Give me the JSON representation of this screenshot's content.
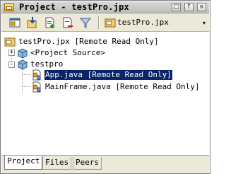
{
  "window": {
    "title": "Project - testPro.jpx",
    "buttons": {
      "restore": "□",
      "pin": "↑",
      "close": "×"
    }
  },
  "toolbar": {
    "project_selector_label": "testPro.jpx",
    "dropdown_glyph": "▾",
    "icons": [
      "project-pane-icon",
      "import-icon",
      "add-files-icon",
      "remove-files-icon",
      "filter-icon",
      "project-file-icon"
    ]
  },
  "tree": {
    "root": {
      "label": "testPro.jpx [Remote Read Only]",
      "icon": "project-file-icon"
    },
    "nodes": [
      {
        "label": "<Project Source>",
        "icon": "package-icon",
        "expanded": false
      },
      {
        "label": "testpro",
        "icon": "package-icon",
        "expanded": true,
        "children": [
          {
            "label": "App.java [Remote Read Only]",
            "icon": "java-class-icon",
            "selected": true
          },
          {
            "label": "MainFrame.java [Remote Read Only]",
            "icon": "java-class-icon",
            "selected": false
          }
        ]
      }
    ],
    "expand_glyph": "+",
    "collapse_glyph": "-"
  },
  "tabs": [
    {
      "label": "Project",
      "active": true
    },
    {
      "label": "Files",
      "active": false
    },
    {
      "label": "Peers",
      "active": false
    }
  ],
  "colors": {
    "selection": "#0a246a",
    "selection_text": "#ffffff",
    "toolbar": "#ece9d8"
  }
}
